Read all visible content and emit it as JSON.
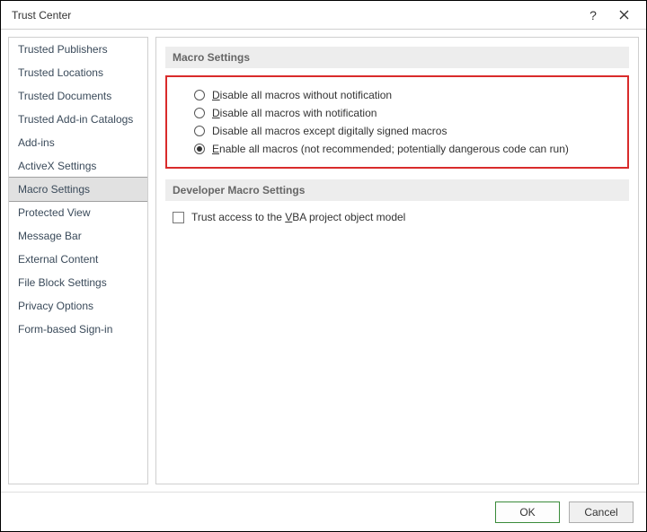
{
  "window": {
    "title": "Trust Center"
  },
  "sidebar": {
    "items": [
      {
        "label": "Trusted Publishers",
        "selected": false
      },
      {
        "label": "Trusted Locations",
        "selected": false
      },
      {
        "label": "Trusted Documents",
        "selected": false
      },
      {
        "label": "Trusted Add-in Catalogs",
        "selected": false
      },
      {
        "label": "Add-ins",
        "selected": false
      },
      {
        "label": "ActiveX Settings",
        "selected": false
      },
      {
        "label": "Macro Settings",
        "selected": true
      },
      {
        "label": "Protected View",
        "selected": false
      },
      {
        "label": "Message Bar",
        "selected": false
      },
      {
        "label": "External Content",
        "selected": false
      },
      {
        "label": "File Block Settings",
        "selected": false
      },
      {
        "label": "Privacy Options",
        "selected": false
      },
      {
        "label": "Form-based Sign-in",
        "selected": false
      }
    ]
  },
  "main": {
    "section1": {
      "title": "Macro Settings"
    },
    "macroOptions": [
      {
        "pre": "",
        "u": "D",
        "post": "isable all macros without notification",
        "checked": false
      },
      {
        "pre": "",
        "u": "D",
        "post": "isable all macros with notification",
        "checked": false
      },
      {
        "pre": "Disable all macros except digitally signed macros",
        "u": "",
        "post": "",
        "checked": false
      },
      {
        "pre": "",
        "u": "E",
        "post": "nable all macros (not recommended; potentially dangerous code can run)",
        "checked": true
      }
    ],
    "section2": {
      "title": "Developer Macro Settings"
    },
    "devCheckbox": {
      "pre": "Trust access to the ",
      "u": "V",
      "post": "BA project object model",
      "checked": false
    }
  },
  "footer": {
    "ok": "OK",
    "cancel": "Cancel"
  }
}
